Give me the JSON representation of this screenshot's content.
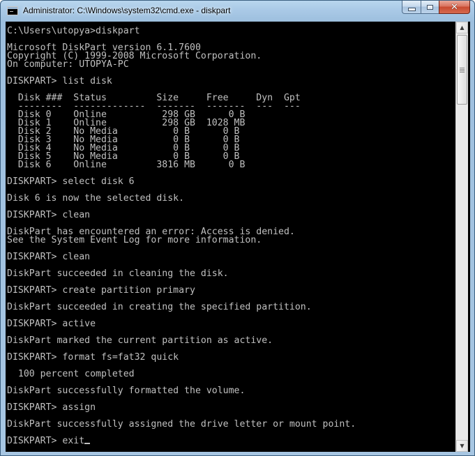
{
  "window": {
    "title": "Administrator: C:\\Windows\\system32\\cmd.exe - diskpart"
  },
  "caption_buttons": {
    "minimize_icon": "minimize-icon",
    "maximize_icon": "maximize-icon",
    "close_icon": "close-icon",
    "close_glyph": "✕"
  },
  "colors": {
    "console_background": "#000000",
    "console_text": "#c0c0c0",
    "close_button": "#c74a30",
    "title_bar": "#a9c9e6"
  },
  "scrollbar": {
    "up_glyph": "▲",
    "down_glyph": "▼"
  },
  "console": {
    "lines": [
      "C:\\Users\\utopya>diskpart",
      "",
      "Microsoft DiskPart version 6.1.7600",
      "Copyright (C) 1999-2008 Microsoft Corporation.",
      "On computer: UTOPYA-PC",
      "",
      "DISKPART> list disk",
      "",
      "  Disk ###  Status         Size     Free     Dyn  Gpt",
      "  --------  -------------  -------  -------  ---  ---",
      "  Disk 0    Online          298 GB      0 B",
      "  Disk 1    Online          298 GB  1028 MB",
      "  Disk 2    No Media          0 B      0 B",
      "  Disk 3    No Media          0 B      0 B",
      "  Disk 4    No Media          0 B      0 B",
      "  Disk 5    No Media          0 B      0 B",
      "  Disk 6    Online         3816 MB      0 B",
      "",
      "DISKPART> select disk 6",
      "",
      "Disk 6 is now the selected disk.",
      "",
      "DISKPART> clean",
      "",
      "DiskPart has encountered an error: Access is denied.",
      "See the System Event Log for more information.",
      "",
      "DISKPART> clean",
      "",
      "DiskPart succeeded in cleaning the disk.",
      "",
      "DISKPART> create partition primary",
      "",
      "DiskPart succeeded in creating the specified partition.",
      "",
      "DISKPART> active",
      "",
      "DiskPart marked the current partition as active.",
      "",
      "DISKPART> format fs=fat32 quick",
      "",
      "  100 percent completed",
      "",
      "DiskPart successfully formatted the volume.",
      "",
      "DISKPART> assign",
      "",
      "DiskPart successfully assigned the drive letter or mount point.",
      "",
      "DISKPART> exit"
    ]
  }
}
